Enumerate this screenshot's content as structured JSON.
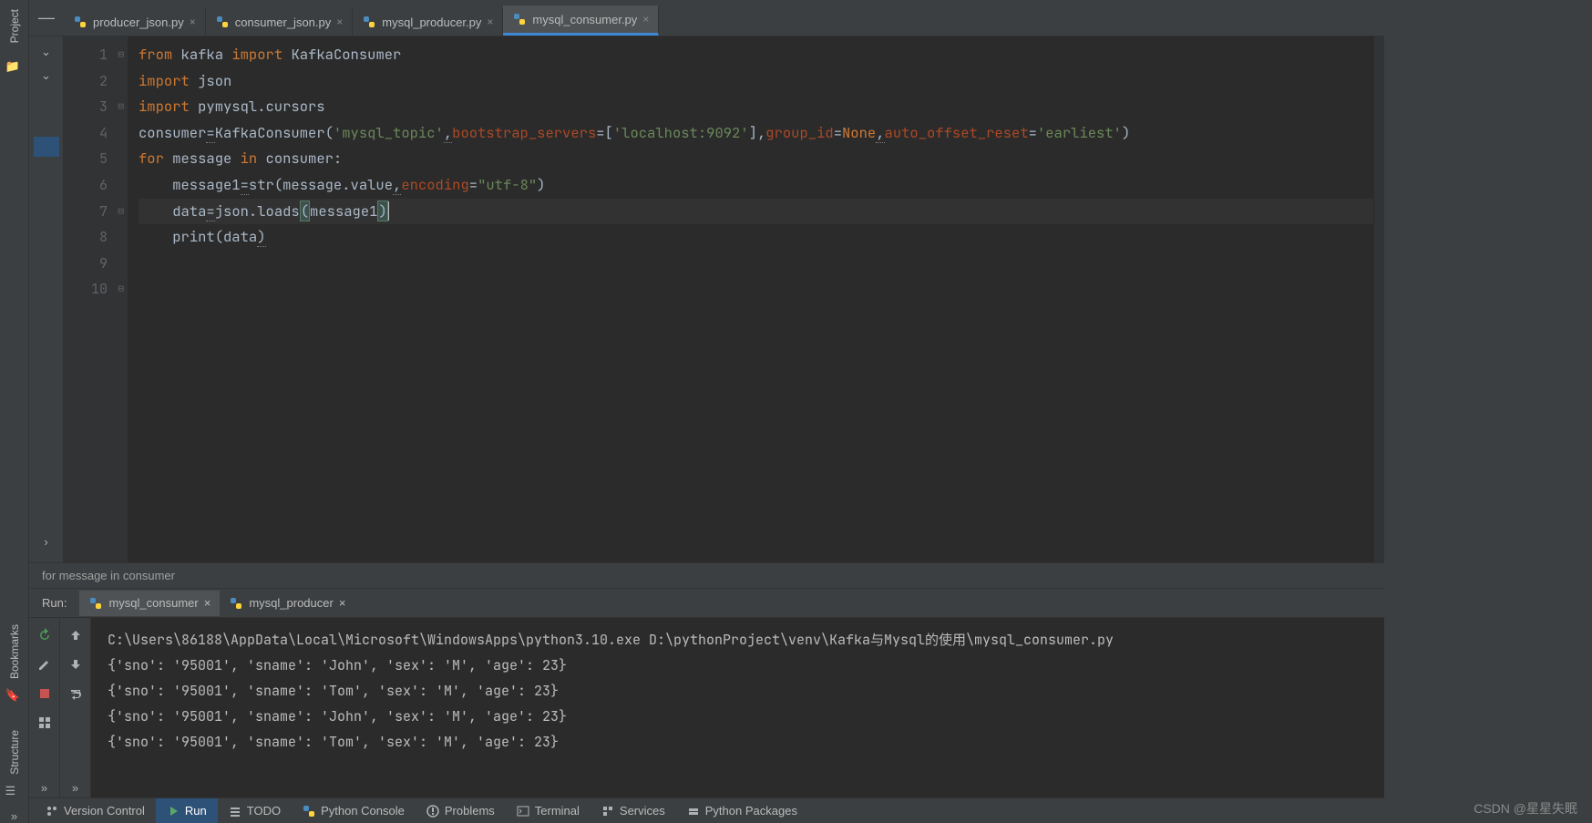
{
  "leftToolbar": {
    "labels": [
      "Project",
      "Bookmarks",
      "Structure"
    ]
  },
  "tabs": [
    {
      "label": "producer_json.py",
      "active": false
    },
    {
      "label": "consumer_json.py",
      "active": false
    },
    {
      "label": "mysql_producer.py",
      "active": false
    },
    {
      "label": "mysql_consumer.py",
      "active": true
    }
  ],
  "gutter": [
    "1",
    "2",
    "3",
    "4",
    "5",
    "6",
    "7",
    "8",
    "9",
    "10"
  ],
  "code": {
    "l1": {
      "a": "from ",
      "b": "kafka ",
      "c": "import ",
      "d": "KafkaConsumer"
    },
    "l2": {
      "a": "import ",
      "b": "json"
    },
    "l3": {
      "a": "import ",
      "b": "pymysql.cursors"
    },
    "l4": "",
    "l5": {
      "a": "consumer",
      "eq": "=",
      "b": "KafkaConsumer(",
      "s1": "'mysql_topic'",
      "c": ",",
      "p1": "bootstrap_servers",
      "d": "=[",
      "s2": "'localhost:9092'",
      "e": "],",
      "p2": "group_id",
      "f": "=",
      "n": "None",
      "g": ",",
      "p3": "auto_offset_reset",
      "h": "=",
      "s3": "'earliest'",
      "i": ")"
    },
    "l6": "",
    "l7": {
      "a": "for ",
      "b": "message ",
      "c": "in ",
      "d": "consumer:"
    },
    "l8": {
      "pad": "    ",
      "a": "message1",
      "eq": "=",
      "b": "str(message.value",
      "c": ",",
      "p": "encoding",
      "d": "=",
      "s": "\"utf-8\"",
      "e": ")"
    },
    "l9": {
      "pad": "    ",
      "a": "data",
      "eq": "=",
      "b": "json.loads",
      "lp": "(",
      "c": "message1",
      "rp": ")"
    },
    "l10": {
      "pad": "    ",
      "a": "print(data",
      "u": ")"
    }
  },
  "breadcrumb": "for message in consumer",
  "runPanel": {
    "label": "Run:",
    "tabs": [
      {
        "label": "mysql_consumer",
        "active": true
      },
      {
        "label": "mysql_producer",
        "active": false
      }
    ],
    "output": [
      "C:\\Users\\86188\\AppData\\Local\\Microsoft\\WindowsApps\\python3.10.exe D:\\pythonProject\\venv\\Kafka与Mysql的使用\\mysql_consumer.py",
      "{'sno': '95001', 'sname': 'John', 'sex': 'M', 'age': 23}",
      "{'sno': '95001', 'sname': 'Tom', 'sex': 'M', 'age': 23}",
      "{'sno': '95001', 'sname': 'John', 'sex': 'M', 'age': 23}",
      "{'sno': '95001', 'sname': 'Tom', 'sex': 'M', 'age': 23}"
    ]
  },
  "bottomBar": [
    {
      "label": "Version Control",
      "icon": "branch"
    },
    {
      "label": "Run",
      "icon": "play",
      "active": true
    },
    {
      "label": "TODO",
      "icon": "list"
    },
    {
      "label": "Python Console",
      "icon": "python"
    },
    {
      "label": "Problems",
      "icon": "warn"
    },
    {
      "label": "Terminal",
      "icon": "term"
    },
    {
      "label": "Services",
      "icon": "svc"
    },
    {
      "label": "Python Packages",
      "icon": "pkg"
    }
  ],
  "watermark": "CSDN @星星失眠"
}
